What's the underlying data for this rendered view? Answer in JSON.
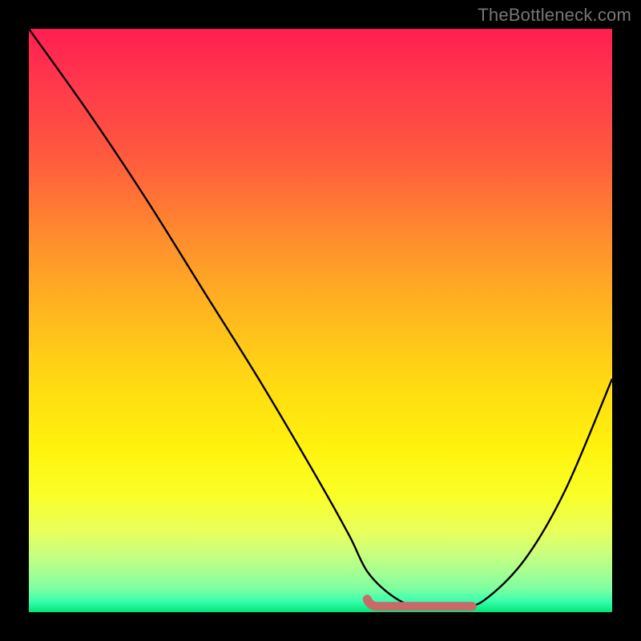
{
  "watermark": "TheBottleneck.com",
  "chart_data": {
    "type": "line",
    "title": "",
    "xlabel": "",
    "ylabel": "",
    "xlim": [
      0,
      100
    ],
    "ylim": [
      0,
      100
    ],
    "grid": false,
    "series": [
      {
        "name": "curve",
        "x": [
          0,
          10,
          20,
          30,
          40,
          50,
          55,
          58,
          62,
          66,
          70,
          74,
          78,
          85,
          92,
          100
        ],
        "values": [
          100,
          86,
          71,
          55,
          39,
          22,
          13,
          7,
          3,
          1,
          1,
          1,
          2,
          9,
          21,
          40
        ]
      }
    ],
    "flat_region": {
      "x_start": 58,
      "x_end": 76,
      "y": 1
    },
    "colors": {
      "curve": "#000000",
      "flat_marker": "#c96a6a",
      "background_top": "#ff1e52",
      "background_bottom": "#00e57a"
    }
  }
}
